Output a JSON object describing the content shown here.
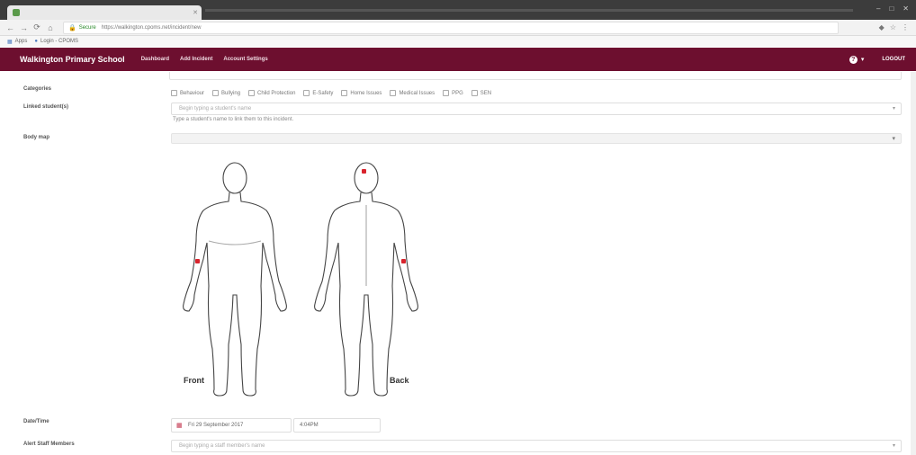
{
  "browser": {
    "tab_title": "",
    "url_secure_label": "Secure",
    "url": "https://walkington.cpoms.net/incident/new",
    "bookmarks": [
      {
        "label": "Apps",
        "icon": "apps-grid-icon"
      },
      {
        "label": "Login - CPOMS",
        "icon": "bookmark-icon"
      }
    ]
  },
  "navbar": {
    "brand": "Walkington Primary School",
    "links": [
      "Dashboard",
      "Add Incident",
      "Account Settings"
    ],
    "help_icon": "?",
    "user_icon_label": "▾",
    "logout": "LOGOUT",
    "color": "#6d0f2f"
  },
  "form": {
    "categories_label": "Categories",
    "categories": [
      "Behaviour",
      "Bullying",
      "Child Protection",
      "E-Safety",
      "Home Issues",
      "Medical Issues",
      "PPG",
      "SEN"
    ],
    "linked_label": "Linked student(s)",
    "linked_placeholder": "Begin typing a student's name",
    "linked_help": "Type a student's name to link them to this incident.",
    "bodymap_label": "Body map",
    "front_label": "Front",
    "back_label": "Back",
    "datetime_label": "Date/Time",
    "date_value": "Fri 29 September 2017",
    "time_value": "4:04PM",
    "alert_staff_label": "Alert Staff Members",
    "alert_staff_placeholder": "Begin typing a staff member's name"
  },
  "colors": {
    "marker": "#d9232d",
    "accent": "#6d0f2f"
  }
}
